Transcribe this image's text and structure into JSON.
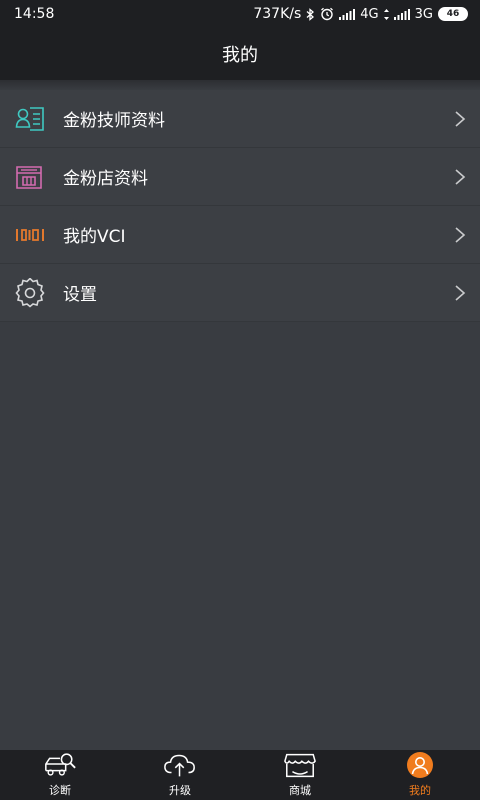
{
  "status_bar": {
    "time": "14:58",
    "net_speed": "737K/s",
    "signal1_label": "4G",
    "signal2_label": "3G",
    "battery": "46"
  },
  "header": {
    "title": "我的"
  },
  "menu": {
    "items": [
      {
        "label": "金粉技师资料",
        "icon": "technician-profile-icon"
      },
      {
        "label": "金粉店资料",
        "icon": "shop-profile-icon"
      },
      {
        "label": "我的VCI",
        "icon": "vci-device-icon"
      },
      {
        "label": "设置",
        "icon": "gear-icon"
      }
    ]
  },
  "bottom_nav": {
    "items": [
      {
        "label": "诊断",
        "icon": "diagnose-car-icon"
      },
      {
        "label": "升级",
        "icon": "cloud-upgrade-icon"
      },
      {
        "label": "商城",
        "icon": "store-icon"
      },
      {
        "label": "我的",
        "icon": "user-icon",
        "active": true
      }
    ]
  },
  "colors": {
    "accent": "#f07c1e",
    "technician_icon": "#3fc9c2",
    "shop_icon": "#d36bb0",
    "vci_icon": "#e2782d",
    "header_bg": "#1e1f22",
    "page_bg": "#393c41"
  }
}
